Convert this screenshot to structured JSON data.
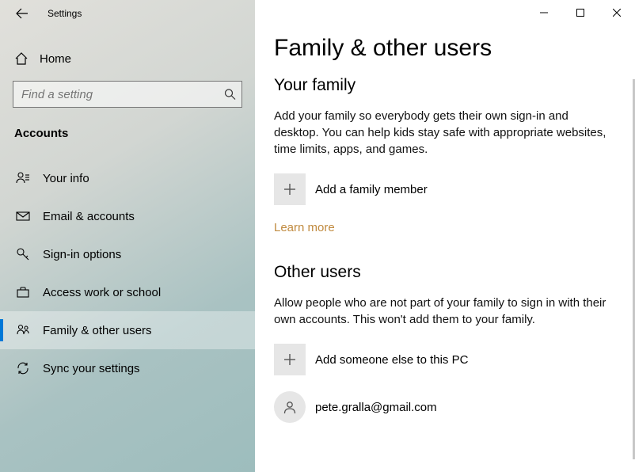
{
  "app_title": "Settings",
  "home_label": "Home",
  "search_placeholder": "Find a setting",
  "category_header": "Accounts",
  "nav": [
    {
      "label": "Your info"
    },
    {
      "label": "Email & accounts"
    },
    {
      "label": "Sign-in options"
    },
    {
      "label": "Access work or school"
    },
    {
      "label": "Family & other users"
    },
    {
      "label": "Sync your settings"
    }
  ],
  "page_title": "Family & other users",
  "family": {
    "heading": "Your family",
    "desc": "Add your family so everybody gets their own sign-in and desktop. You can help kids stay safe with appropriate websites, time limits, apps, and games.",
    "add_label": "Add a family member",
    "learn_more": "Learn more"
  },
  "other": {
    "heading": "Other users",
    "desc": "Allow people who are not part of your family to sign in with their own accounts. This won't add them to your family.",
    "add_label": "Add someone else to this PC",
    "users": [
      {
        "email": "pete.gralla@gmail.com"
      }
    ]
  }
}
